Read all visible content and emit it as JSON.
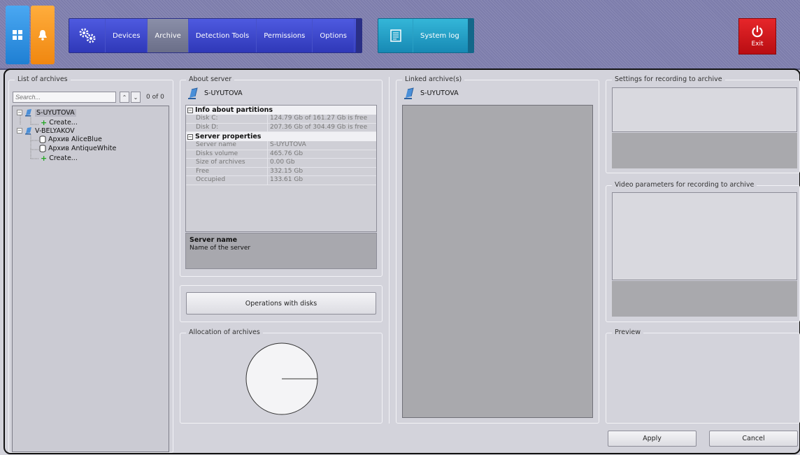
{
  "toolbar": {
    "tabs": [
      "Devices",
      "Archive",
      "Detection Tools",
      "Permissions",
      "Options"
    ],
    "active_tab": "Archive",
    "system_log_label": "System log",
    "exit_label": "Exit",
    "colors": {
      "main_group": "#3b44c8",
      "log_group": "#1f9ac4",
      "exit": "#d51a1f"
    }
  },
  "archives_panel": {
    "title": "List of archives",
    "search_placeholder": "Search...",
    "count": "0 of 0",
    "tree": {
      "server1": "S-UYUTOVA",
      "server1_create": "Create...",
      "server2": "V-BELYAKOV",
      "archive1": "Архив AliceBlue",
      "archive2": "Архив AntiqueWhite",
      "server2_create": "Create..."
    }
  },
  "about_server": {
    "title": "About server",
    "server_name": "S-UYUTOVA",
    "partitions_header": "Info about partitions",
    "partitions": [
      {
        "key": "Disk C:",
        "value": "124.79 Gb of 161.27 Gb is free"
      },
      {
        "key": "Disk D:",
        "value": "207.36 Gb of 304.49 Gb is free"
      }
    ],
    "properties_header": "Server properties",
    "properties": [
      {
        "key": "Server name",
        "value": "S-UYUTOVA"
      },
      {
        "key": "Disks volume",
        "value": "465.76 Gb"
      },
      {
        "key": "Size of archives",
        "value": "0.00 Gb"
      },
      {
        "key": "Free",
        "value": "332.15 Gb"
      },
      {
        "key": "Occupied",
        "value": "133.61 Gb"
      }
    ],
    "desc_title": "Server name",
    "desc_text": "Name of the server"
  },
  "disks": {
    "button": "Operations with disks"
  },
  "allocation": {
    "title": "Allocation of archives"
  },
  "linked": {
    "title": "Linked archive(s)",
    "server_name": "S-UYUTOVA"
  },
  "settings": {
    "title": "Settings for recording to archive"
  },
  "video_params": {
    "title": "Video parameters for recording to archive"
  },
  "preview": {
    "title": "Preview"
  },
  "footer": {
    "apply": "Apply",
    "cancel": "Cancel"
  }
}
